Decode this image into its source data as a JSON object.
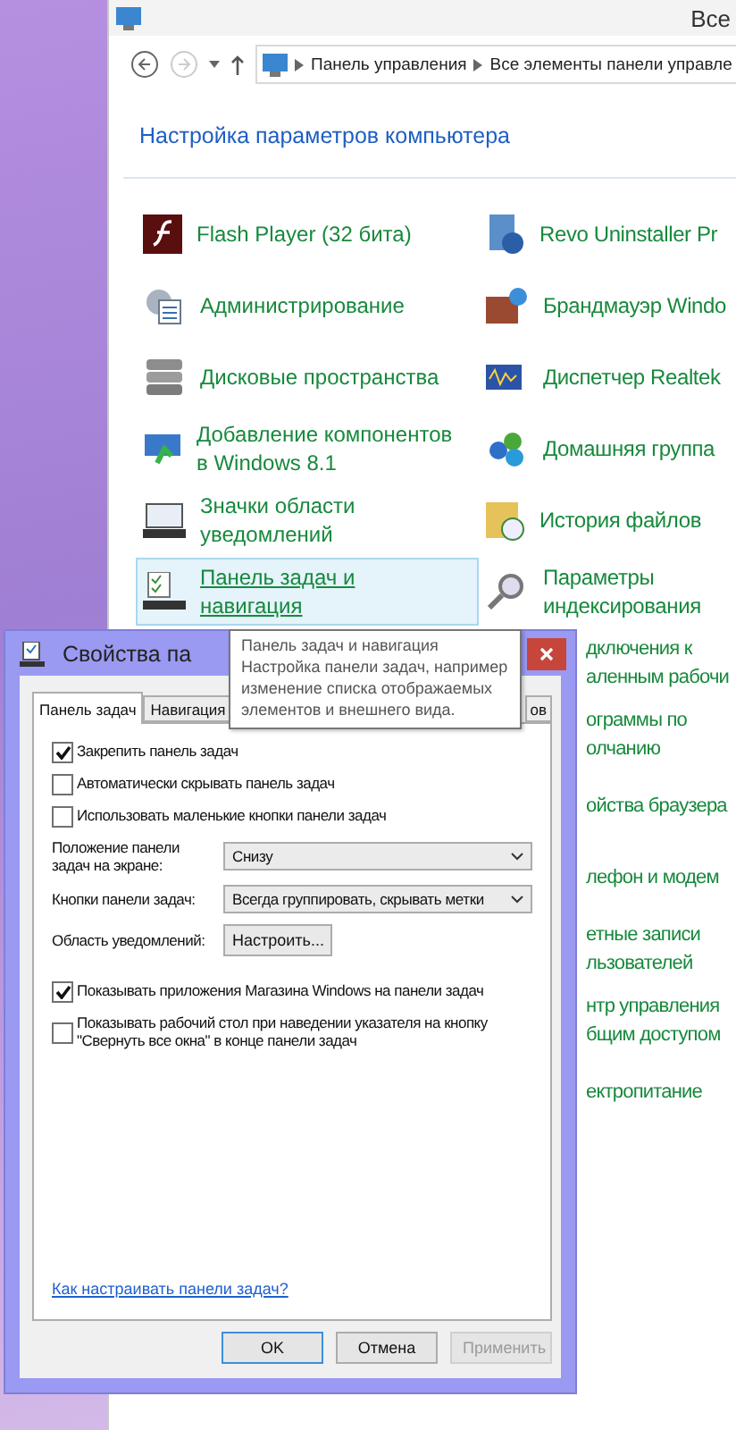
{
  "explorer": {
    "title": "Все",
    "breadcrumbs": [
      "Панель управления",
      "Все элементы панели управле"
    ],
    "heading": "Настройка параметров компьютера",
    "items_left": [
      {
        "label": "Flash Player (32 бита)",
        "selected": false
      },
      {
        "label": "Администрирование",
        "selected": false
      },
      {
        "label": "Дисковые пространства",
        "selected": false
      },
      {
        "label": "Добавление компонентов\nв Windows 8.1",
        "selected": false
      },
      {
        "label": "Значки области\nуведомлений",
        "selected": false
      },
      {
        "label": "Панель задач и\nнавигация",
        "selected": true
      }
    ],
    "items_right": [
      {
        "label": "Revo Uninstaller Pr",
        "kind": "full"
      },
      {
        "label": "Брандмауэр Windo",
        "kind": "full"
      },
      {
        "label": "Диспетчер Realtek",
        "kind": "full"
      },
      {
        "label": "Домашняя группа",
        "kind": "full"
      },
      {
        "label": "История файлов",
        "kind": "full"
      },
      {
        "label": "Параметры\nиндексирования",
        "kind": "full"
      },
      {
        "label": "дключения к\nаленным рабочи",
        "kind": "clipped"
      },
      {
        "label": "ограммы по\nолчанию",
        "kind": "clipped"
      },
      {
        "label": "ойства браузера",
        "kind": "clipped"
      },
      {
        "label": "лефон и модем",
        "kind": "clipped"
      },
      {
        "label": "етные записи\nльзователей",
        "kind": "clipped"
      },
      {
        "label": "нтр управления\nбщим доступом",
        "kind": "clipped"
      },
      {
        "label": "ектропитание",
        "kind": "clipped"
      }
    ]
  },
  "tooltip": {
    "title": "Панель задач и навигация",
    "text": "Настройка панели задач, например\nизменение списка отображаемых\nэлементов и внешнего вида."
  },
  "dialog": {
    "title": "Свойства па",
    "tabs": [
      {
        "label": "Панель задач",
        "selected": true
      },
      {
        "label": "Навигация",
        "selected": false
      },
      {
        "label": "ов",
        "selected": false
      }
    ],
    "options": [
      {
        "kind": "checkbox",
        "label": "Закрепить панель задач",
        "checked": true
      },
      {
        "kind": "checkbox",
        "label": "Автоматически скрывать панель задач",
        "checked": false
      },
      {
        "kind": "checkbox",
        "label": "Использовать маленькие кнопки панели задач",
        "checked": false
      },
      {
        "kind": "select",
        "label": "Положение панели\nзадач на экране:",
        "value": "Снизу"
      },
      {
        "kind": "select",
        "label": "Кнопки панели задач:",
        "value": "Всегда группировать, скрывать метки"
      },
      {
        "kind": "button",
        "label": "Область уведомлений:",
        "button": "Настроить..."
      },
      {
        "kind": "checkbox",
        "label": "Показывать приложения Магазина Windows на панели задач",
        "checked": true
      },
      {
        "kind": "checkbox",
        "label": "Показывать рабочий стол при наведении указателя на кнопку\n\"Свернуть все окна\" в конце панели задач",
        "checked": false
      }
    ],
    "link": "Как настраивать панели задач?",
    "buttons": [
      {
        "label": "OK",
        "default": true,
        "disabled": false
      },
      {
        "label": "Отмена",
        "default": false,
        "disabled": false
      },
      {
        "label": "Применить",
        "default": false,
        "disabled": true
      }
    ]
  }
}
